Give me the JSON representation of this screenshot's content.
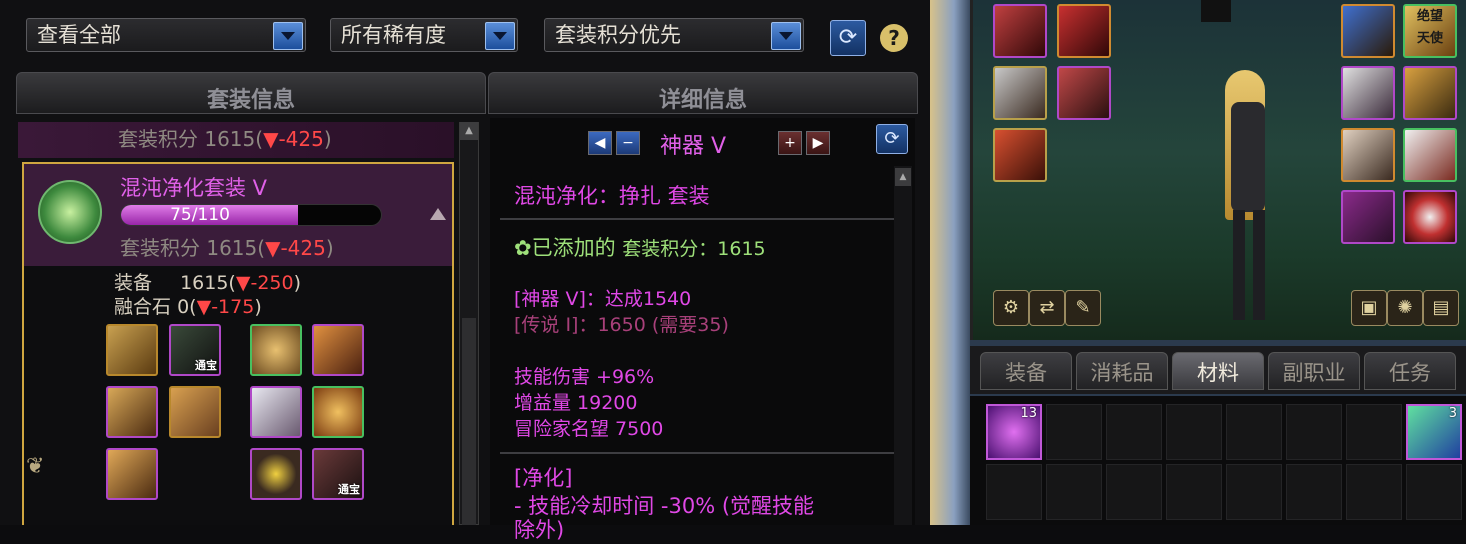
{
  "filters": {
    "view_all": "查看全部",
    "rarity": "所有稀有度",
    "sort": "套装积分优先"
  },
  "panels": {
    "set_info_title": "套装信息",
    "detail_title": "详细信息"
  },
  "set_list": {
    "prev_row": {
      "label": "套装积分",
      "score": "1615",
      "delta": "-425"
    },
    "selected": {
      "name": "混沌净化套装 V",
      "progress_text": "75/110",
      "progress_fraction": 0.68,
      "score_label": "套装积分",
      "score": "1615",
      "score_delta": "-425",
      "equip_label": "装备",
      "equip_value": "1615",
      "equip_delta": "-250",
      "fusion_label": "融合石",
      "fusion_value": "0",
      "fusion_delta": "-175",
      "badge_text": "通宝"
    }
  },
  "detail": {
    "grade": "神器 V",
    "set_line": "混沌净化：挣扎  套装",
    "added_label": "已添加的",
    "added_score_label": "套装积分：1615",
    "tier1": "[神器 V]：达成1540",
    "tier2": "[传说 I]：1650 (需要35)",
    "stats": [
      "技能伤害 +96%",
      "增益量 19200",
      "冒险家名望 7500"
    ],
    "effect_title": "[净化]",
    "effect_line": "- 技能冷却时间 -30% (觉醒技能",
    "effect_line2": "除外)"
  },
  "equipment_panel": {
    "title_badge": "绝望\n天使"
  },
  "inventory": {
    "tabs": [
      "装备",
      "消耗品",
      "材料",
      "副职业",
      "任务"
    ],
    "active_tab": "材料",
    "item_qty": "13",
    "item_qty2": "3"
  },
  "colors": {
    "accent_magenta": "#e048e6",
    "delta_red": "#ff4848",
    "gold_border": "#cfa640"
  }
}
